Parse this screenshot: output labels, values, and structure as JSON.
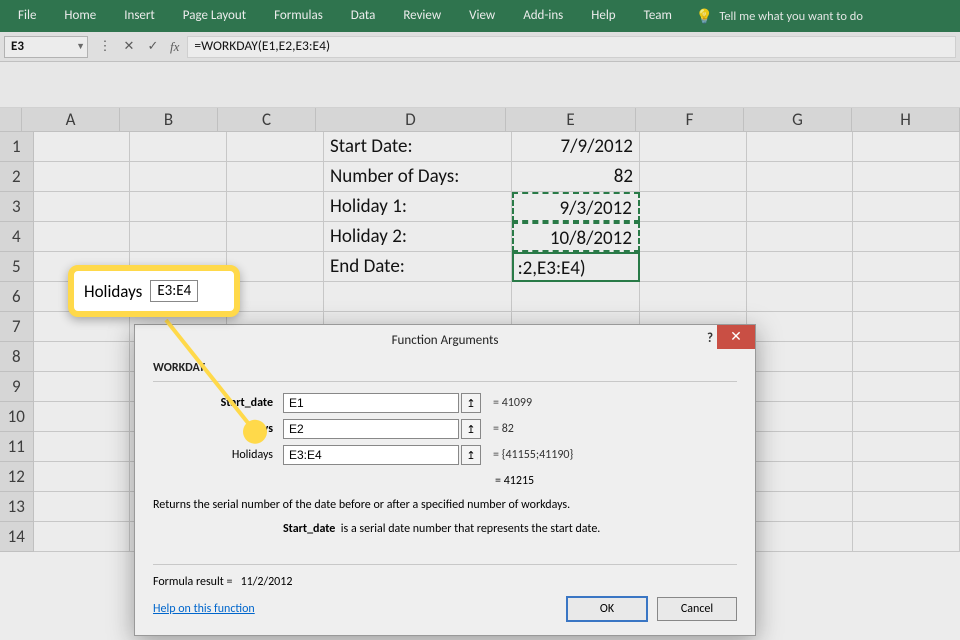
{
  "ribbon": {
    "tabs": [
      "File",
      "Home",
      "Insert",
      "Page Layout",
      "Formulas",
      "Data",
      "Review",
      "View",
      "Add-ins",
      "Help",
      "Team"
    ],
    "tellme": "Tell me what you want to do"
  },
  "namebox": "E3",
  "formula": "=WORKDAY(E1,E2,E3:E4)",
  "columns": [
    "A",
    "B",
    "C",
    "D",
    "E",
    "F",
    "G",
    "H"
  ],
  "row_count": 14,
  "cells": {
    "D1": "Start Date:",
    "E1": "7/9/2012",
    "D2": "Number of Days:",
    "E2": "82",
    "D3": "Holiday 1:",
    "E3": "9/3/2012",
    "D4": "Holiday 2:",
    "E4": "10/8/2012",
    "D5": "End Date:",
    "E5": ":2,E3:E4)"
  },
  "callout": {
    "label": "Holidays",
    "value": "E3:E4"
  },
  "dialog": {
    "title": "Function Arguments",
    "func": "WORKDAY",
    "args": [
      {
        "label": "Start_date",
        "bold": true,
        "value": "E1",
        "result": "41099"
      },
      {
        "label": "Days",
        "bold": true,
        "value": "E2",
        "result": "82"
      },
      {
        "label": "Holidays",
        "bold": false,
        "value": "E3:E4",
        "result": "{41155;41190}"
      }
    ],
    "evaluated": "41215",
    "description": "Returns the serial number of the date before or after a specified number of workdays.",
    "arg_help": {
      "name": "Start_date",
      "text": "is a serial date number that represents the start date."
    },
    "formula_result_label": "Formula result =",
    "formula_result": "11/2/2012",
    "help_link": "Help on this function",
    "ok": "OK",
    "cancel": "Cancel"
  }
}
